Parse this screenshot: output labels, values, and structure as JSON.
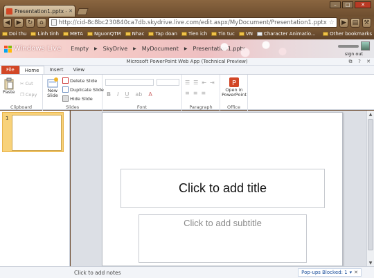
{
  "browser": {
    "tab_title": "Presentation1.pptx - Micr...",
    "url": "http://cid-8c8bc230840ca7db.skydrive.live.com/edit.aspx/MyDocument/Presentation1.pptx",
    "bookmarks": [
      "Doi thu",
      "Linh tinh",
      "META",
      "NguonQTM",
      "Nhac",
      "Tap doan",
      "Tien ich",
      "Tin tuc",
      "VN",
      "Character Animatio..."
    ],
    "other_bookmarks": "Other bookmarks"
  },
  "live": {
    "logo_text": "Windows Live",
    "crumbs": [
      "Empty",
      "SkyDrive",
      "MyDocument",
      "Presentation1.pptx"
    ],
    "sign_out": "sign out"
  },
  "app": {
    "title": "Microsoft PowerPoint Web App (Technical Preview)"
  },
  "ribbon": {
    "tabs": [
      "File",
      "Home",
      "Insert",
      "View"
    ],
    "clipboard": {
      "paste": "Paste",
      "cut": "Cut",
      "copy": "Copy",
      "label": "Clipboard"
    },
    "slides": {
      "new_slide": "New Slide",
      "delete": "Delete Slide",
      "duplicate": "Duplicate Slide",
      "hide": "Hide Slide",
      "label": "Slides"
    },
    "font": {
      "label": "Font",
      "bold": "B",
      "italic": "I",
      "underline": "U",
      "color": "A"
    },
    "paragraph": {
      "label": "Paragraph"
    },
    "office": {
      "open": "Open in PowerPoint",
      "label": "Office"
    }
  },
  "slides": {
    "thumb_number": "1"
  },
  "slide": {
    "title_placeholder": "Click to add title",
    "subtitle_placeholder": "Click to add subtitle"
  },
  "status": {
    "notes": "Click to add notes",
    "popups": "Pop-ups Blocked: 1"
  },
  "colors": {
    "file_tab": "#d24726",
    "selection": "#f8d27a"
  }
}
